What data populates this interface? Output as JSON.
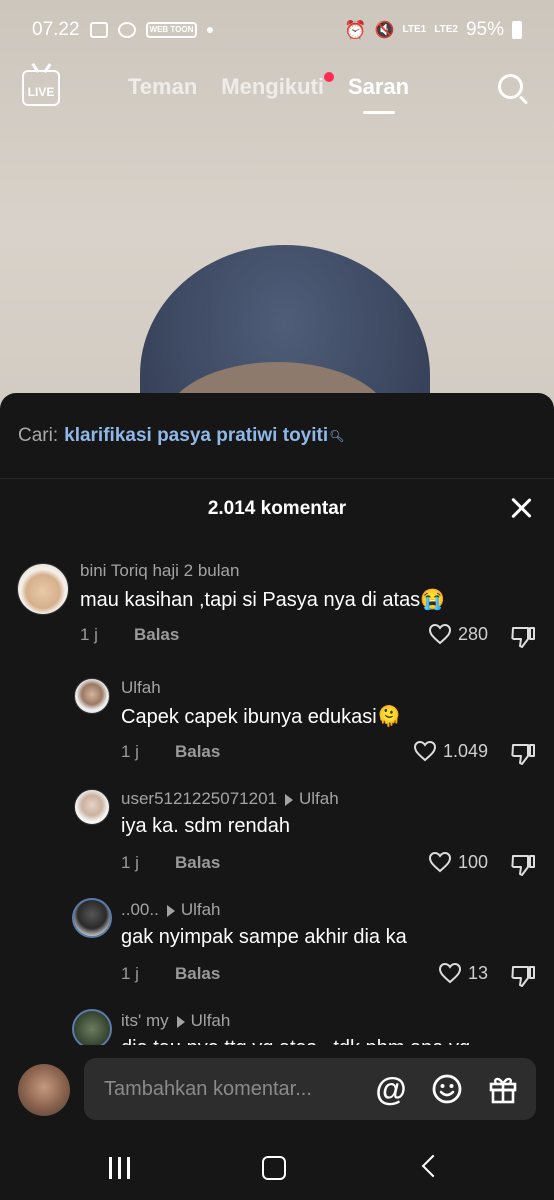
{
  "status_bar": {
    "time": "07.22",
    "notif_badge": "WEB TOON",
    "lte1": "LTE1",
    "lte2": "LTE2",
    "battery": "95%"
  },
  "top_nav": {
    "live_label": "LIVE",
    "tabs": [
      {
        "label": "Teman",
        "active": false
      },
      {
        "label": "Mengikuti",
        "active": false,
        "has_dot": true
      },
      {
        "label": "Saran",
        "active": true
      }
    ]
  },
  "search_suggestion": {
    "prefix": "Cari:",
    "term": "klarifikasi pasya pratiwi toyiti"
  },
  "comments_header": {
    "title": "2.014 komentar"
  },
  "comments": [
    {
      "username": "bini Toriq haji 2 bulan",
      "reply_to": "",
      "text": "mau kasihan ,tapi si Pasya nya di atas😭",
      "time": "1 j",
      "reply_label": "Balas",
      "likes": "280"
    },
    {
      "username": "Ulfah",
      "reply_to": "",
      "text": "Capek capek ibunya edukasi🫠",
      "time": "1 j",
      "reply_label": "Balas",
      "likes": "1.049"
    },
    {
      "username": "user5121225071201",
      "reply_to": "Ulfah",
      "text": "iya ka. sdm rendah",
      "time": "1 j",
      "reply_label": "Balas",
      "likes": "100"
    },
    {
      "username": "..00..",
      "reply_to": "Ulfah",
      "text": "gak nyimpak sampe akhir dia ka",
      "time": "1 j",
      "reply_label": "Balas",
      "likes": "13"
    },
    {
      "username": "its' my",
      "reply_to": "Ulfah",
      "text": "dia tau nya ttg yg atas.. tdk phm apa yg"
    }
  ],
  "input": {
    "placeholder": "Tambahkan komentar..."
  },
  "colors": {
    "sheet_bg": "#161616",
    "search_term": "#8fb8e8",
    "notification_dot": "#fe2c55"
  }
}
